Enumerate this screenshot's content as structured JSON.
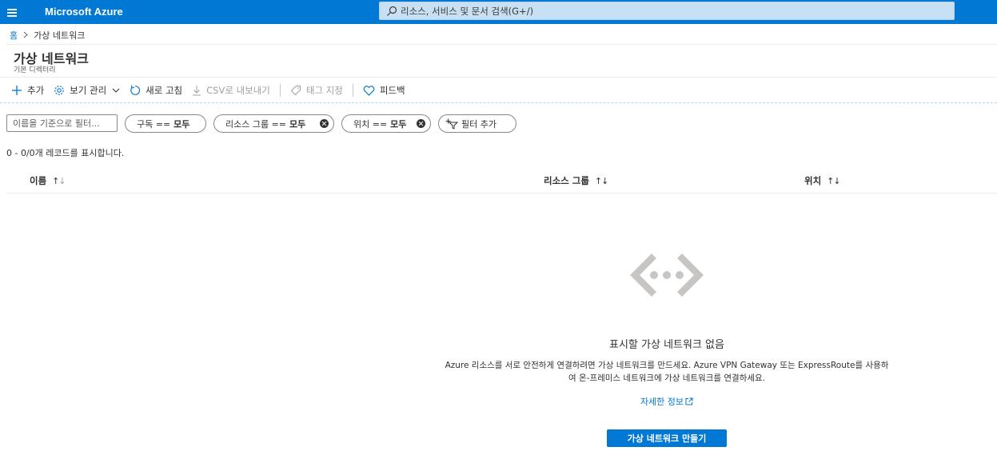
{
  "topbar": {
    "brand": "Microsoft Azure",
    "search_placeholder": "리소스, 서비스 및 문서 검색(G+/)"
  },
  "breadcrumb": {
    "home": "홈",
    "current": "가상 네트워크"
  },
  "page": {
    "title": "가상 네트워크",
    "subtitle": "기본 디렉터리"
  },
  "toolbar": {
    "add": "추가",
    "manage_view": "보기 관리",
    "refresh": "새로 고침",
    "export_csv": "CSV로 내보내기",
    "assign_tags": "태그 지정",
    "feedback": "피드백"
  },
  "filters": {
    "name_placeholder": "이름을 기준으로 필터...",
    "subscription": {
      "label": "구독 ==",
      "value": "모두"
    },
    "resource_group": {
      "label": "리소스 그룹 ==",
      "value": "모두"
    },
    "location": {
      "label": "위치 ==",
      "value": "모두"
    },
    "add_filter": "필터 추가"
  },
  "records_text": "0 - 0/0개 레코드를 표시합니다.",
  "table": {
    "columns": [
      "이름",
      "리소스 그룹",
      "위치"
    ]
  },
  "empty_state": {
    "title": "표시할 가상 네트워크 없음",
    "description_line1": "Azure 리소스를 서로 안전하게 연결하려면 가상 네트워크를 만드세요. Azure VPN Gateway 또는 ExpressRoute를 사용하",
    "description_line2": "여 온-프레미스 네트워크에 가상 네트워크를 연결하세요.",
    "learn_more": "자세한 정보",
    "create_button": "가상 네트워크 만들기"
  },
  "colors": {
    "accent": "#0078d4",
    "search_bg": "#c7e0f4"
  }
}
